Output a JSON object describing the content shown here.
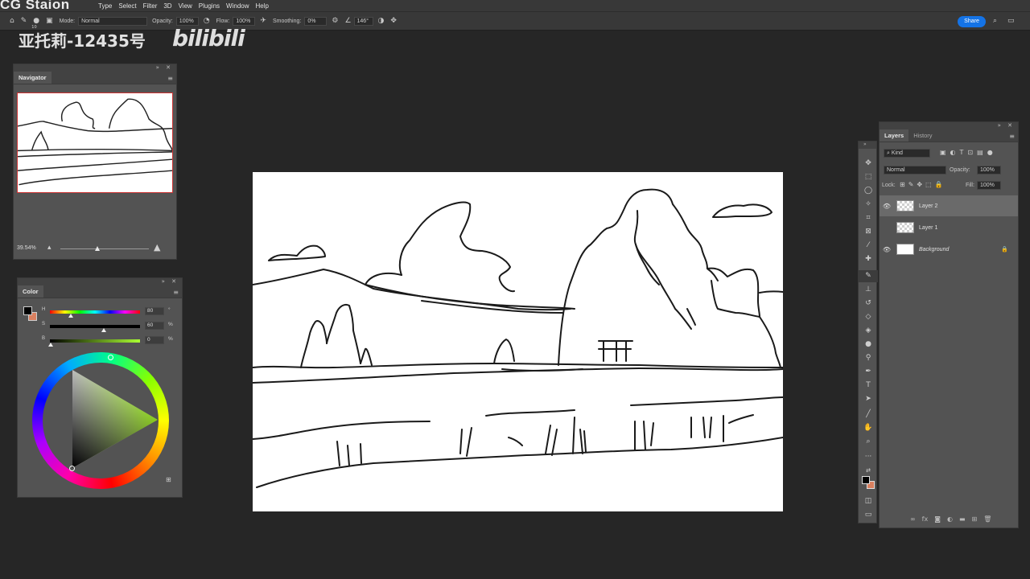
{
  "menubar": {
    "items": [
      "Type",
      "Select",
      "Filter",
      "3D",
      "View",
      "Plugins",
      "Window",
      "Help"
    ]
  },
  "watermark": {
    "site": "CG Staion",
    "user": "亚托莉-12435号",
    "logo": "bilibili"
  },
  "options_bar": {
    "mode_label": "Mode:",
    "mode_value": "Normal",
    "opacity_label": "Opacity:",
    "opacity_value": "100%",
    "flow_label": "Flow:",
    "flow_value": "100%",
    "smoothing_label": "Smoothing:",
    "smoothing_value": "0%",
    "angle_value": "146°",
    "brush_size": "10",
    "share_label": "Share"
  },
  "navigator": {
    "tab": "Navigator",
    "zoom": "39.54%",
    "zoom_slider_fraction": 0.52
  },
  "color_panel": {
    "tab": "Color",
    "h_label": "H",
    "h_value": "80",
    "h_unit": "°",
    "s_label": "S",
    "s_value": "60",
    "s_unit": "%",
    "b_label": "B",
    "b_value": "0",
    "b_unit": "%",
    "foreground": "#000000",
    "background": "#d98060"
  },
  "layers_panel": {
    "tab_layers": "Layers",
    "tab_history": "History",
    "filter_label": "Kind",
    "blend_mode": "Normal",
    "opacity_label": "Opacity:",
    "opacity_value": "100%",
    "lock_label": "Lock:",
    "fill_label": "Fill:",
    "fill_value": "100%",
    "layers": [
      {
        "name": "Layer 2",
        "visible": true,
        "selected": true
      },
      {
        "name": "Layer 1",
        "visible": false,
        "selected": false
      },
      {
        "name": "Background",
        "visible": true,
        "selected": false,
        "locked": true
      }
    ]
  },
  "colors": {
    "app_bg": "#262626",
    "panel_bg": "#535353",
    "accent": "#1473e6"
  }
}
